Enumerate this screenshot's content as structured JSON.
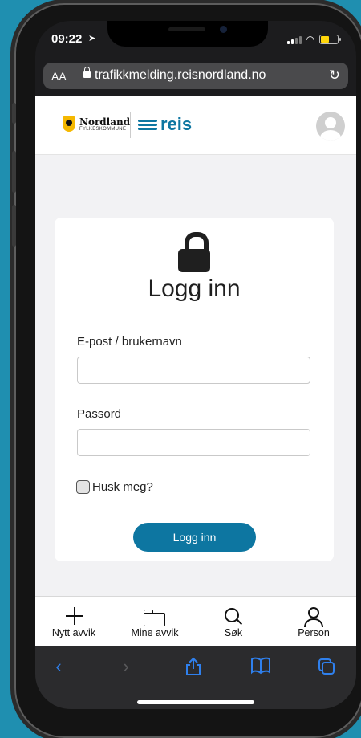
{
  "status": {
    "time": "09:22"
  },
  "browser": {
    "aa_label": "AA",
    "url": "trafikkmelding.reisnordland.no"
  },
  "header": {
    "nordland_name": "Nordland",
    "nordland_sub": "FYLKESKOMMUNE",
    "reis_name": "reis"
  },
  "login": {
    "title": "Logg inn",
    "email_label": "E-post / brukernavn",
    "email_value": "",
    "password_label": "Passord",
    "password_value": "",
    "remember_label": "Husk meg?",
    "remember_checked": false,
    "submit_label": "Logg inn"
  },
  "tabs": [
    {
      "label": "Nytt avvik",
      "icon": "plus-icon"
    },
    {
      "label": "Mine avvik",
      "icon": "folder-icon"
    },
    {
      "label": "Søk",
      "icon": "search-icon"
    },
    {
      "label": "Person",
      "icon": "person-icon"
    }
  ],
  "safari_toolbar": {
    "back_icon": "chevron-left-icon",
    "forward_icon": "chevron-right-icon",
    "share_icon": "share-icon",
    "bookmarks_icon": "book-icon",
    "tabs_icon": "tabs-icon"
  },
  "colors": {
    "brand": "#0d76a1",
    "background": "#1f8fb0",
    "nordland_yellow": "#f5b800",
    "ios_link_blue": "#2f80ed"
  }
}
